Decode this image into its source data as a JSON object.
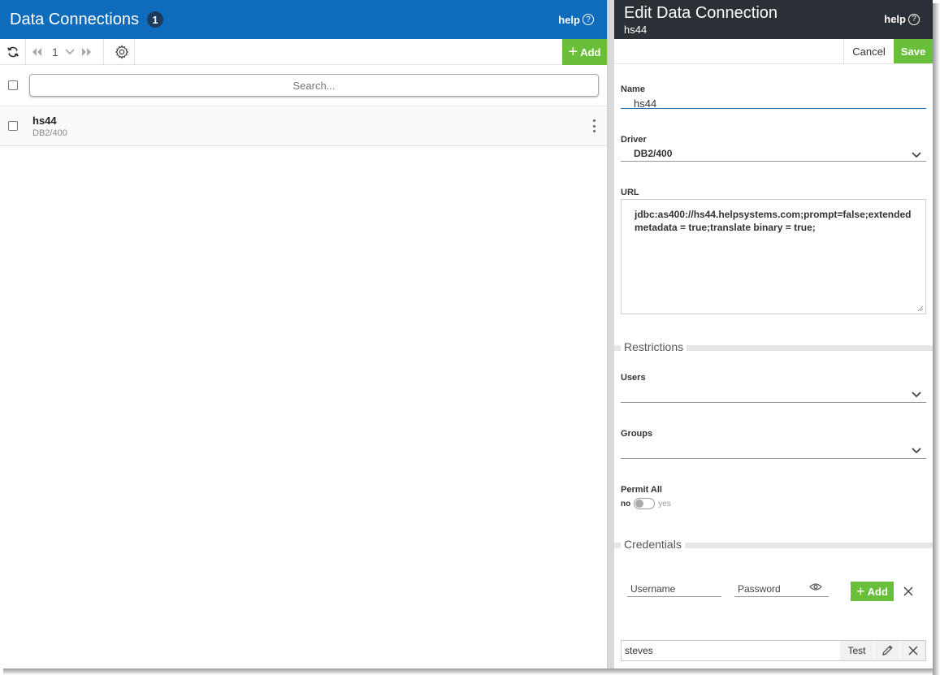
{
  "left": {
    "title": "Data Connections",
    "count": "1",
    "help": "help",
    "help_icon": "?",
    "page_number": "1",
    "add_label": "Add",
    "search_placeholder": "Search...",
    "rows": [
      {
        "name": "hs44",
        "driver": "DB2/400"
      }
    ]
  },
  "right": {
    "title": "Edit Data Connection",
    "subtitle": "hs44",
    "help": "help",
    "help_icon": "?",
    "cancel_label": "Cancel",
    "save_label": "Save",
    "name_label": "Name",
    "name_value": "hs44",
    "driver_label": "Driver",
    "driver_value": "DB2/400",
    "url_label": "URL",
    "url_value": "jdbc:as400://hs44.helpsystems.com;prompt=false;extended metadata = true;translate binary = true;",
    "restrictions_title": "Restrictions",
    "users_label": "Users",
    "groups_label": "Groups",
    "permit_all_label": "Permit All",
    "toggle_no": "no",
    "toggle_yes": "yes",
    "credentials_title": "Credentials",
    "username_placeholder": "Username",
    "password_placeholder": "Password",
    "cred_add_label": "Add",
    "credential_user": "steves",
    "test_label": "Test"
  },
  "colors": {
    "header_blue": "#0f6cbd",
    "header_dark": "#2b2f36",
    "accent_green": "#6abf3a"
  }
}
